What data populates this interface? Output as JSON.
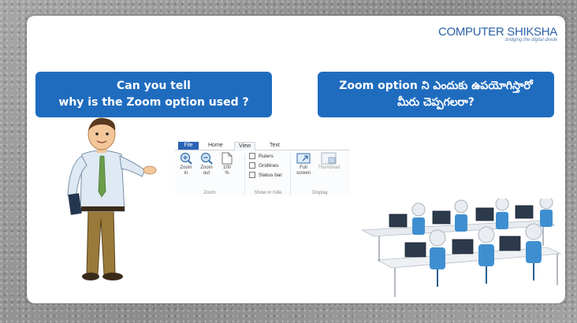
{
  "logo": {
    "brand": "COMPUTER SHIKSHA",
    "tagline": "bridging the digital divide"
  },
  "question_english": {
    "line1": "Can you tell",
    "line2": "why is the Zoom option used ?"
  },
  "question_telugu": {
    "line1": "Zoom option ని ఎందుకు ఉపయోగిస్తారో",
    "line2": "మీరు చెప్పగలరా?"
  },
  "ribbon": {
    "tabs": [
      "File",
      "Home",
      "View",
      "Text"
    ],
    "zoom_group": {
      "label": "Zoom",
      "zoom_in": {
        "line1": "Zoom",
        "line2": "in",
        "icon": "zoom-in-icon"
      },
      "zoom_out": {
        "line1": "Zoom",
        "line2": "out",
        "icon": "zoom-out-icon"
      },
      "hundred": {
        "line1": "100",
        "line2": "%",
        "icon": "page-icon"
      }
    },
    "show_hide_group": {
      "label": "Show or hide",
      "checkboxes": [
        "Rulers",
        "Gridlines",
        "Status bar"
      ]
    },
    "display_group": {
      "label": "Display",
      "full_screen": {
        "line1": "Full",
        "line2": "screen",
        "icon": "full-screen-icon"
      },
      "thumbnail": {
        "label": "Thumbnail",
        "icon": "thumbnail-icon"
      }
    }
  },
  "colors": {
    "bubble": "#1f6cbf",
    "file_tab": "#2b64b6",
    "logo": "#2d63a8"
  }
}
